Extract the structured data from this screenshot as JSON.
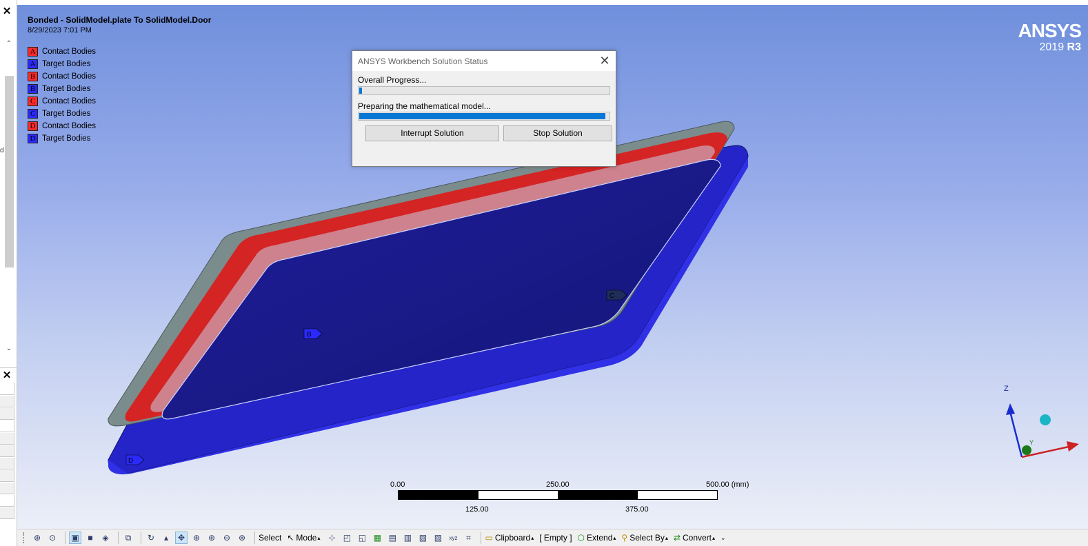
{
  "left_panel": {
    "close_top": "✕",
    "close_mid": "✕",
    "scroll_up": "⌃",
    "scroll_down": "⌄",
    "edge_char": "d"
  },
  "viewport": {
    "title": "Bonded - SolidModel.plate To SolidModel.Door",
    "date": "8/29/2023 7:01 PM",
    "legend": [
      {
        "letter": "A",
        "label": "Contact Bodies",
        "color": "red"
      },
      {
        "letter": "A",
        "label": "Target Bodies",
        "color": "blue"
      },
      {
        "letter": "B",
        "label": "Contact Bodies",
        "color": "red"
      },
      {
        "letter": "B",
        "label": "Target Bodies",
        "color": "blue"
      },
      {
        "letter": "C",
        "label": "Contact Bodies",
        "color": "red"
      },
      {
        "letter": "C",
        "label": "Target Bodies",
        "color": "blue"
      },
      {
        "letter": "D",
        "label": "Contact Bodies",
        "color": "red"
      },
      {
        "letter": "D",
        "label": "Target Bodies",
        "color": "blue"
      }
    ],
    "brand": {
      "name": "ANSYS",
      "version_year": "2019",
      "version_release": "R3"
    },
    "markers": {
      "b": "B",
      "c": "C",
      "d": "D"
    },
    "scale": {
      "t0": "0.00",
      "t250": "250.00",
      "t500": "500.00 (mm)",
      "t125": "125.00",
      "t375": "375.00"
    },
    "triad": {
      "z": "Z",
      "y": "Y"
    }
  },
  "dialog": {
    "title": "ANSYS Workbench Solution Status",
    "overall_label": "Overall Progress...",
    "overall_progress": 0.01,
    "step_label": "Preparing the mathematical model...",
    "step_progress": 0.985,
    "interrupt_label": "Interrupt Solution",
    "stop_label": "Stop Solution",
    "close_glyph": "✕"
  },
  "toolbar": {
    "select": "Select",
    "mode": "Mode",
    "clipboard": "Clipboard",
    "empty": "[ Empty ]",
    "extend": "Extend",
    "select_by": "Select By",
    "convert": "Convert"
  },
  "colors": {
    "accent_blue": "#0677d4",
    "contact_red": "#ff2a2a",
    "target_blue": "#2a2aff"
  }
}
